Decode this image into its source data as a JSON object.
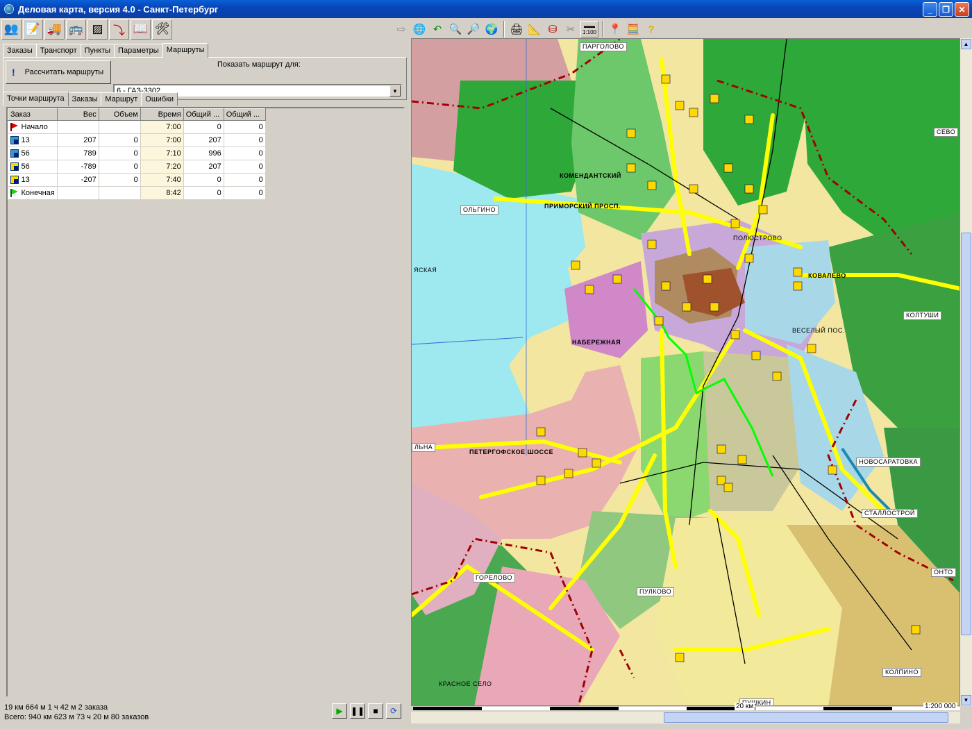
{
  "window": {
    "title": "Деловая карта, версия 4.0 - Санкт-Петербург"
  },
  "toolbar_left": [
    "people-icon",
    "document-icon",
    "truck-icon",
    "bus-icon",
    "hatch-icon",
    "route-icon",
    "book-icon",
    "tools-icon"
  ],
  "toolbar_right": [
    "globe-icon",
    "undo-icon",
    "zoom-in-icon",
    "zoom-out-icon",
    "earth-icon",
    "print-icon",
    "compass-icon",
    "layers-icon",
    "scissors-icon",
    "scale-icon",
    "pin-icon",
    "calculator-icon",
    "help-icon"
  ],
  "scale_button": "1:100",
  "main_tabs": [
    "Заказы",
    "Транспорт",
    "Пункты",
    "Параметры",
    "Маршруты"
  ],
  "active_main_tab": "Маршруты",
  "calc_button": "Рассчитать маршруты",
  "show_route_label": "Показать маршрут для:",
  "vehicle_select": "6 - ГАЗ-3302",
  "sub_tabs": [
    "Точки маршрута",
    "Заказы",
    "Маршрут",
    "Ошибки"
  ],
  "active_sub_tab": "Точки маршрута",
  "columns": [
    "Заказ",
    "Вес",
    "Объем",
    "Время",
    "Общий ...",
    "Общий ..."
  ],
  "rows": [
    {
      "icon": "start-flag",
      "order": "Начало",
      "weight": "",
      "volume": "",
      "time": "7:00",
      "total1": "0",
      "total2": "0"
    },
    {
      "icon": "pickup",
      "order": "13",
      "weight": "207",
      "volume": "0",
      "time": "7:00",
      "total1": "207",
      "total2": "0"
    },
    {
      "icon": "pickup",
      "order": "56",
      "weight": "789",
      "volume": "0",
      "time": "7:10",
      "total1": "996",
      "total2": "0"
    },
    {
      "icon": "delivery",
      "order": "56",
      "weight": "-789",
      "volume": "0",
      "time": "7:20",
      "total1": "207",
      "total2": "0"
    },
    {
      "icon": "delivery",
      "order": "13",
      "weight": "-207",
      "volume": "0",
      "time": "7:40",
      "total1": "0",
      "total2": "0"
    },
    {
      "icon": "end-flag",
      "order": "Конечная",
      "weight": "",
      "volume": "",
      "time": "8:42",
      "total1": "0",
      "total2": "0"
    }
  ],
  "status": {
    "line1": "19 км 664 м  1 ч 42 м  2 заказа",
    "line2": "Всего: 940 км 623 м  73 ч 20 м  80 заказов"
  },
  "map_labels": [
    "ПАРГОЛОВО",
    "СЕВО",
    "ОЛЬГИНО",
    "ПРИМОРСКИЙ ПРОСП.",
    "КОМЕНДАНТСКИЙ",
    "ПОЛЮСТРОВО",
    "КОВАЛЕВО",
    "КОЛТУШИ",
    "НАБЕРЕЖНАЯ",
    "ВЕСЕЛЫЙ ПОС.",
    "ЛЬНА",
    "ПЕТЕРГОФСКОЕ ШОССЕ",
    "НОВОСАРАТОВКА",
    "СТАЛЛОСТРОЙ",
    "ГОРЕЛОВО",
    "ПУЛКОВО",
    "ОНТО",
    "КОЛПИНО",
    "КРАСНОЕ СЕЛО",
    "ПУШКИН",
    "ЯСКАЯ"
  ],
  "map_scale_km": "20 км",
  "map_scale_ratio": "1:200 000",
  "colors": {
    "sea": "#9ee8f0",
    "forest": "#2fa83a",
    "urban": "#c8a8d8",
    "road": "#ffff00",
    "route": "#00ff00",
    "border": "#a00000"
  }
}
